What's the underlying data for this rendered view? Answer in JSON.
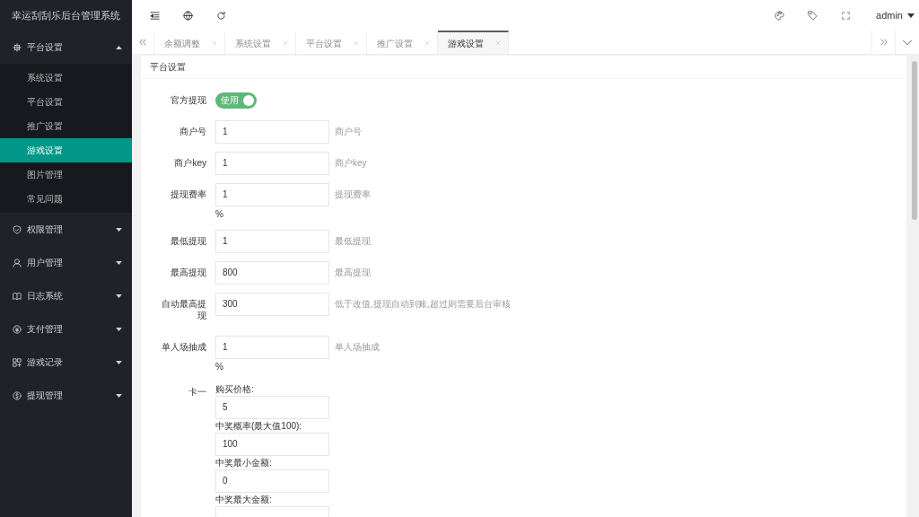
{
  "sidebar": {
    "title": "幸运刮刮乐后台管理系统",
    "menu": [
      {
        "label": "平台设置",
        "expanded": true,
        "children": [
          {
            "label": "系统设置",
            "selected": false
          },
          {
            "label": "平台设置",
            "selected": false
          },
          {
            "label": "推广设置",
            "selected": false
          },
          {
            "label": "游戏设置",
            "selected": true
          },
          {
            "label": "图片管理",
            "selected": false
          },
          {
            "label": "常见问题",
            "selected": false
          }
        ]
      },
      {
        "label": "权限管理",
        "expanded": false
      },
      {
        "label": "用户管理",
        "expanded": false
      },
      {
        "label": "日志系统",
        "expanded": false
      },
      {
        "label": "支付管理",
        "expanded": false
      },
      {
        "label": "游戏记录",
        "expanded": false
      },
      {
        "label": "提现管理",
        "expanded": false
      }
    ]
  },
  "header": {
    "user": "admin"
  },
  "tabs": [
    {
      "label": "余额调整",
      "selected": false
    },
    {
      "label": "系统设置",
      "selected": false
    },
    {
      "label": "平台设置",
      "selected": false
    },
    {
      "label": "推广设置",
      "selected": false
    },
    {
      "label": "游戏设置",
      "selected": true
    }
  ],
  "card": {
    "title": "平台设置",
    "fields": [
      {
        "kind": "switch",
        "label": "官方提现",
        "on": true,
        "text": "使用"
      },
      {
        "kind": "input",
        "label": "商户号",
        "value": "1",
        "help": "商户号"
      },
      {
        "kind": "input",
        "label": "商户key",
        "value": "1",
        "help": "商户key"
      },
      {
        "kind": "input",
        "label": "提现费率",
        "value": "1",
        "help": "提现费率",
        "unit": "%"
      },
      {
        "kind": "input",
        "label": "最低提现",
        "value": "1",
        "help": "最低提现"
      },
      {
        "kind": "input",
        "label": "最高提现",
        "value": "800",
        "help": "最高提现"
      },
      {
        "kind": "input",
        "label": "自动最高提现",
        "value": "300",
        "help": "低于改值,提现自动到账,超过则需要后台审核"
      },
      {
        "kind": "input",
        "label": "单人场抽成",
        "value": "1",
        "help": "单人场抽成",
        "unit": "%"
      },
      {
        "kind": "group",
        "label": "卡一",
        "items": [
          {
            "label": "购买价格:",
            "value": "5"
          },
          {
            "label": "中奖概率(最大值100):",
            "value": "100"
          },
          {
            "label": "中奖最小金额:",
            "value": "0"
          },
          {
            "label": "中奖最大金额:"
          }
        ]
      }
    ]
  }
}
